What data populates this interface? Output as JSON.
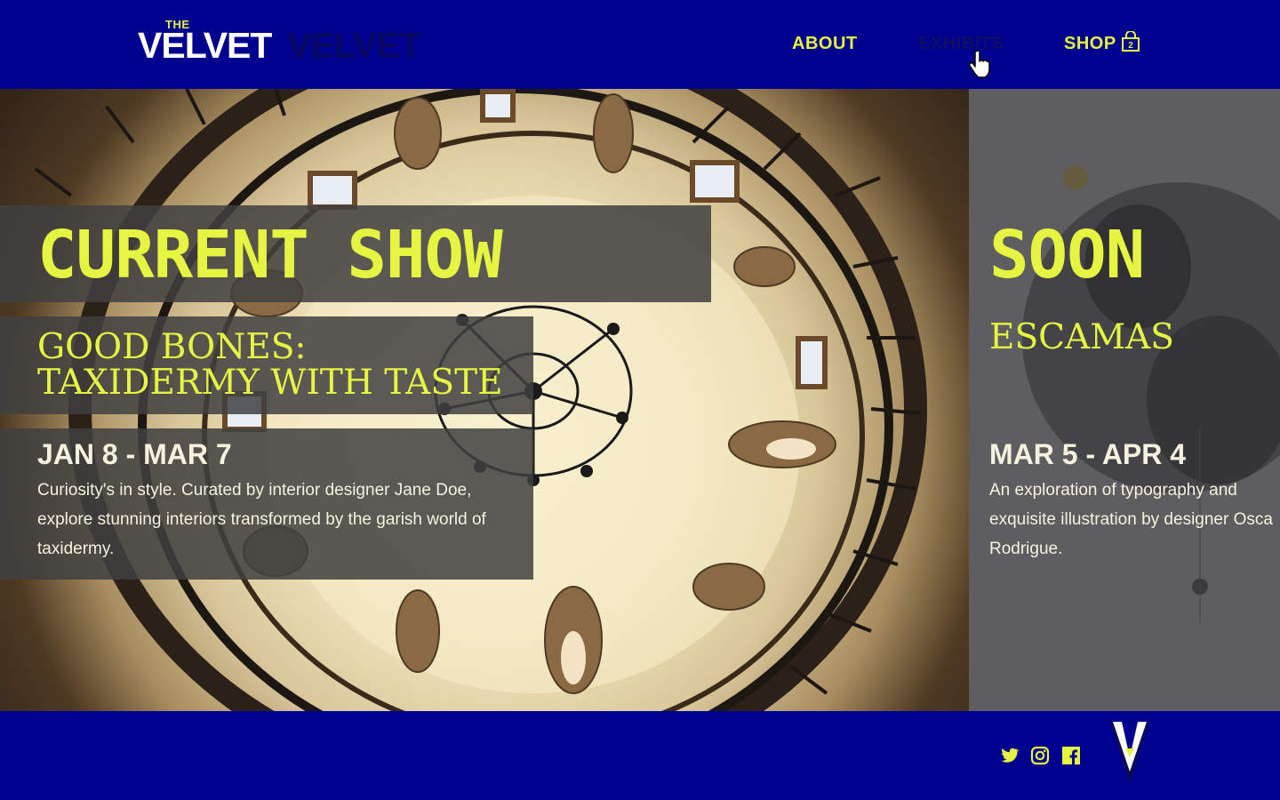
{
  "brand": {
    "logo_the": "THE",
    "logo_word": "VELVET",
    "logo_shadow_word": "VELVET"
  },
  "nav": {
    "items": [
      {
        "label": "ABOUT"
      },
      {
        "label": "EXHIBITS"
      },
      {
        "label": "SHOP"
      }
    ],
    "cart_count": "2"
  },
  "current": {
    "heading": "CURRENT SHOW",
    "title": "GOOD BONES: TAXIDERMY WITH TASTE",
    "dates": "JAN 8 - MAR 7",
    "description": "Curiosity's in style. Curated by interior designer Jane Doe, explore stunning interiors transformed by the garish world of taxidermy."
  },
  "soon": {
    "heading": "SOON",
    "title": "ESCAMAS",
    "dates": "MAR 5 - APR 4",
    "description": "An exploration of typography and exquisite illustration by designer Osca Rodrigue."
  },
  "footer": {
    "social": [
      "twitter-icon",
      "instagram-icon",
      "facebook-icon"
    ]
  },
  "colors": {
    "brand_blue": "#00008f",
    "accent_yellow": "#e6f542",
    "panel_gray": "#5e5e60",
    "text_cream": "#f7f1df"
  }
}
